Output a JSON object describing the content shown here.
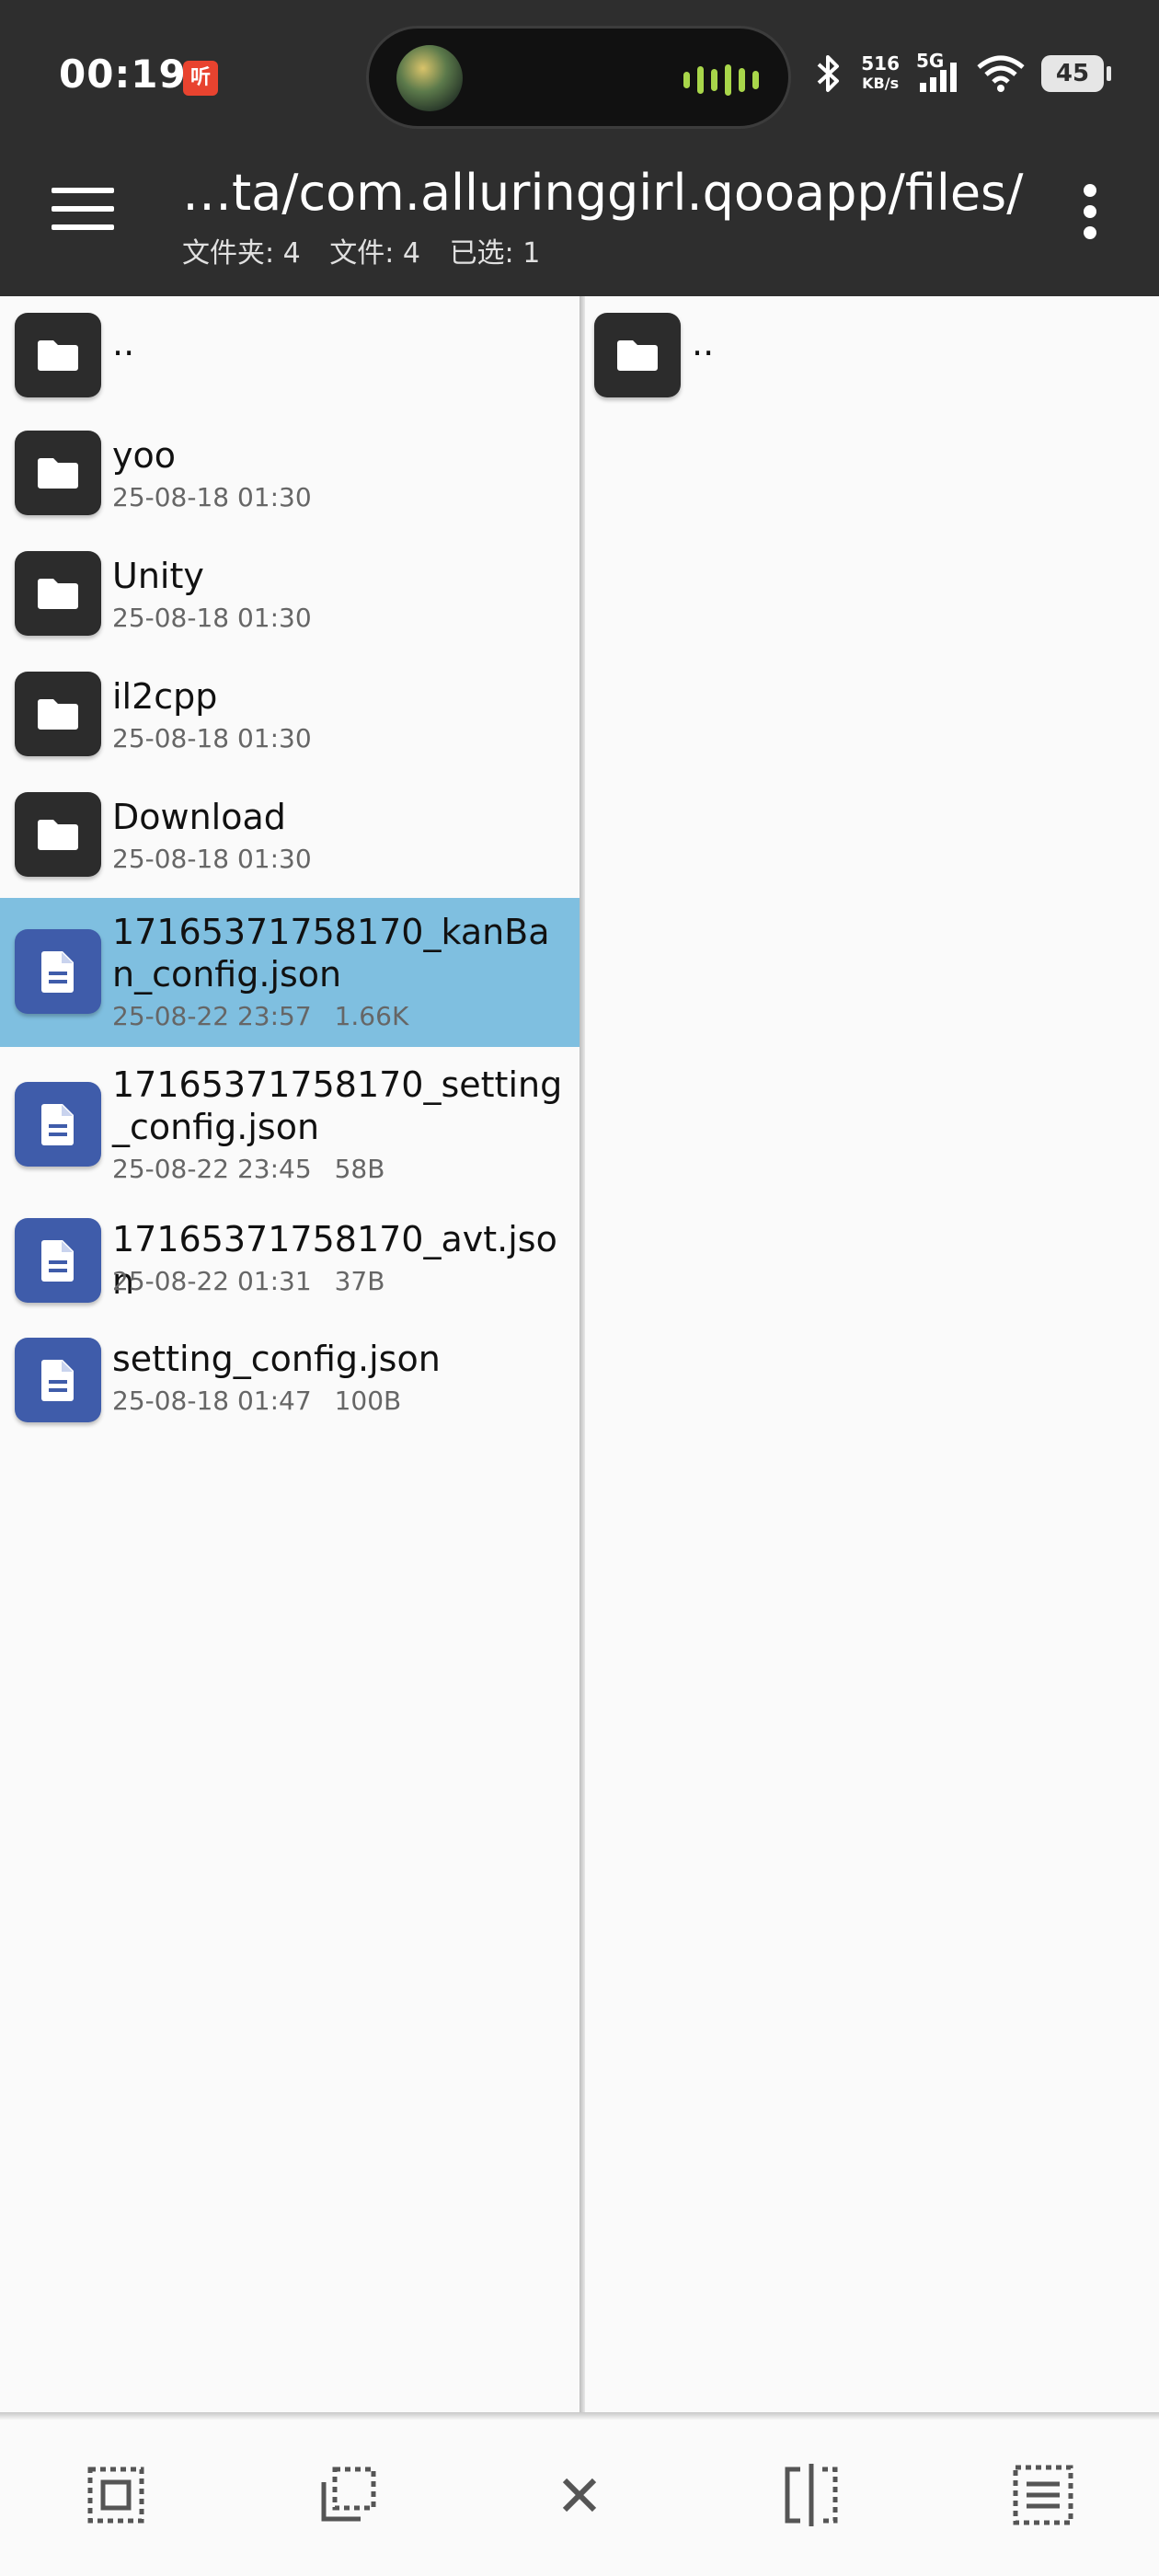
{
  "status_bar": {
    "time": "00:19",
    "app_badge": "听",
    "net_speed_value": "516",
    "net_speed_unit": "KB/s",
    "signal_label": "5G",
    "battery": "45"
  },
  "header": {
    "path": "…ta/com.alluringgirl.qooapp/files/",
    "stats": {
      "folders": "文件夹: 4",
      "files": "文件: 4",
      "selected": "已选: 1"
    }
  },
  "left_pane": {
    "items": [
      {
        "type": "folder",
        "name": "..",
        "date": "",
        "size": "",
        "selected": false
      },
      {
        "type": "folder",
        "name": "yoo",
        "date": "25-08-18 01:30",
        "size": "",
        "selected": false
      },
      {
        "type": "folder",
        "name": "Unity",
        "date": "25-08-18 01:30",
        "size": "",
        "selected": false
      },
      {
        "type": "folder",
        "name": "il2cpp",
        "date": "25-08-18 01:30",
        "size": "",
        "selected": false
      },
      {
        "type": "folder",
        "name": "Download",
        "date": "25-08-18 01:30",
        "size": "",
        "selected": false
      },
      {
        "type": "file",
        "name": "17165371758170_kanBan_config.json",
        "date": "25-08-22 23:57",
        "size": "1.66K",
        "selected": true
      },
      {
        "type": "file",
        "name": "17165371758170_setting_config.json",
        "date": "25-08-22 23:45",
        "size": "58B",
        "selected": false
      },
      {
        "type": "file",
        "name": "17165371758170_avt.json",
        "date": "25-08-22 01:31",
        "size": "37B",
        "selected": false
      },
      {
        "type": "file",
        "name": "setting_config.json",
        "date": "25-08-18 01:47",
        "size": "100B",
        "selected": false
      }
    ]
  },
  "right_pane": {
    "items": [
      {
        "type": "folder",
        "name": ".."
      }
    ]
  },
  "toolbar": {
    "buttons": [
      "select-all-icon",
      "select-range-icon",
      "close-icon",
      "split-view-icon",
      "list-select-icon"
    ]
  },
  "colors": {
    "topbar": "#2e2e2e",
    "selected_row": "#7fbfe0",
    "doc_icon": "#3f5caa",
    "folder_icon": "#2c2c2c"
  }
}
